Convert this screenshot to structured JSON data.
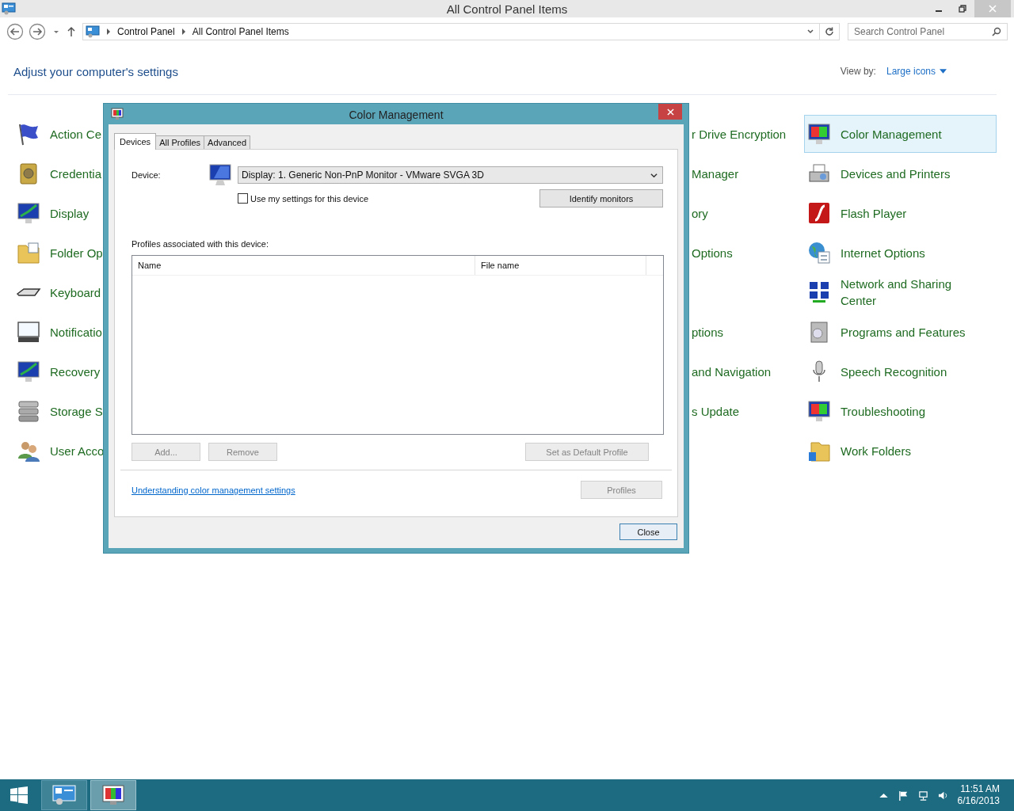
{
  "window": {
    "title": "All Control Panel Items"
  },
  "address": {
    "crumbs": [
      "Control Panel",
      "All Control Panel Items"
    ],
    "search_placeholder": "Search Control Panel"
  },
  "heading": "Adjust your computer's settings",
  "view_by": {
    "label": "View by:",
    "value": "Large icons"
  },
  "items": {
    "rows": [
      {
        "column_1": {
          "label": "Action Ce",
          "selected": false
        },
        "column_2": {
          "label": "r Drive Encryption"
        },
        "column_3": {
          "label": "Color Management",
          "selected": true
        }
      },
      {
        "column_1": {
          "label": "Credentia",
          "selected": false
        },
        "column_2": {
          "label": "Manager"
        },
        "column_3": {
          "label": "Devices and Printers",
          "selected": false
        }
      },
      {
        "column_1": {
          "label": "Display",
          "selected": false
        },
        "column_2": {
          "label": "ory"
        },
        "column_3": {
          "label": "Flash Player",
          "selected": false
        }
      },
      {
        "column_1": {
          "label": "Folder Op",
          "selected": false
        },
        "column_2": {
          "label": "Options"
        },
        "column_3": {
          "label": "Internet Options",
          "selected": false
        }
      },
      {
        "column_1": {
          "label": "Keyboard",
          "selected": false
        },
        "column_3": {
          "label": "Network and Sharing Center",
          "selected": false
        }
      },
      {
        "column_1": {
          "label": "Notificatio",
          "selected": false
        },
        "column_2": {
          "label": "ptions"
        },
        "column_3": {
          "label": "Programs and Features",
          "selected": false
        }
      },
      {
        "column_1": {
          "label": "Recovery",
          "selected": false
        },
        "column_2": {
          "label": "and Navigation"
        },
        "column_3": {
          "label": "Speech Recognition",
          "selected": false
        }
      },
      {
        "column_1": {
          "label": "Storage S",
          "selected": false
        },
        "column_2": {
          "label": "s Update"
        },
        "column_3": {
          "label": "Troubleshooting",
          "selected": false
        }
      },
      {
        "column_1": {
          "label": "User Acco",
          "selected": false
        },
        "column_3": {
          "label": "Work Folders",
          "selected": false
        }
      }
    ]
  },
  "dialog": {
    "title": "Color Management",
    "tabs": [
      {
        "label": "Devices",
        "selected": true
      },
      {
        "label": "All Profiles",
        "selected": false
      },
      {
        "label": "Advanced",
        "selected": false
      }
    ],
    "device_label": "Device:",
    "device_value": "Display: 1. Generic Non-PnP Monitor - VMware SVGA 3D",
    "checkbox": {
      "label": "Use my settings for this device",
      "checked": false
    },
    "identify_button": "Identify monitors",
    "profiles_label": "Profiles associated with this device:",
    "table": {
      "columns": [
        "Name",
        "File name"
      ]
    },
    "profile_buttons": [
      {
        "label": "Add...",
        "disabled": true
      },
      {
        "label": "Remove",
        "disabled": true
      },
      {
        "label": "Set as Default Profile",
        "disabled": true
      }
    ],
    "link": "Understanding color management settings",
    "profiles_button": {
      "label": "Profiles",
      "disabled": true
    },
    "close_button": "Close"
  },
  "taskbar": {
    "apps": [
      {
        "selected": false
      },
      {
        "selected": true
      }
    ],
    "time": "11:51 AM",
    "date": "6/16/2013"
  }
}
